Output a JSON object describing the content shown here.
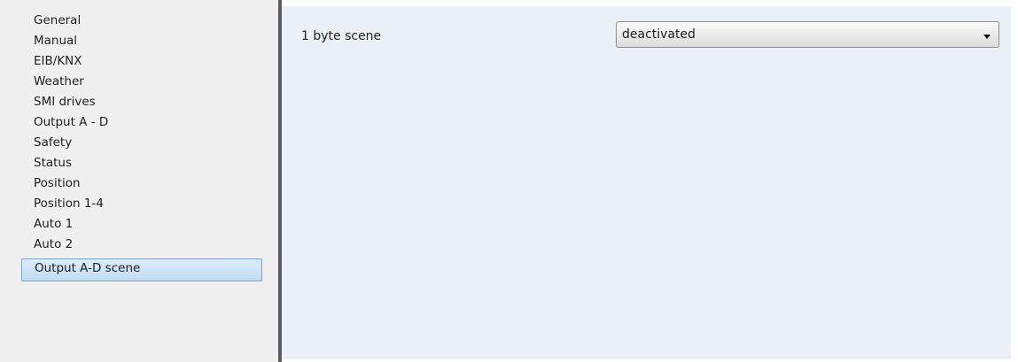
{
  "sidebar": {
    "items": [
      {
        "label": "General"
      },
      {
        "label": "Manual"
      },
      {
        "label": "EIB/KNX"
      },
      {
        "label": "Weather"
      },
      {
        "label": "SMI drives"
      },
      {
        "label": "Output A - D"
      },
      {
        "label": "Safety"
      },
      {
        "label": "Status"
      },
      {
        "label": "Position"
      },
      {
        "label": "Position 1-4"
      },
      {
        "label": "Auto 1"
      },
      {
        "label": "Auto 2"
      },
      {
        "label": "Output A-D scene"
      }
    ],
    "selected": "Output A-D scene"
  },
  "main": {
    "parameter_label": "1 byte scene",
    "parameter_value": "deactivated"
  }
}
